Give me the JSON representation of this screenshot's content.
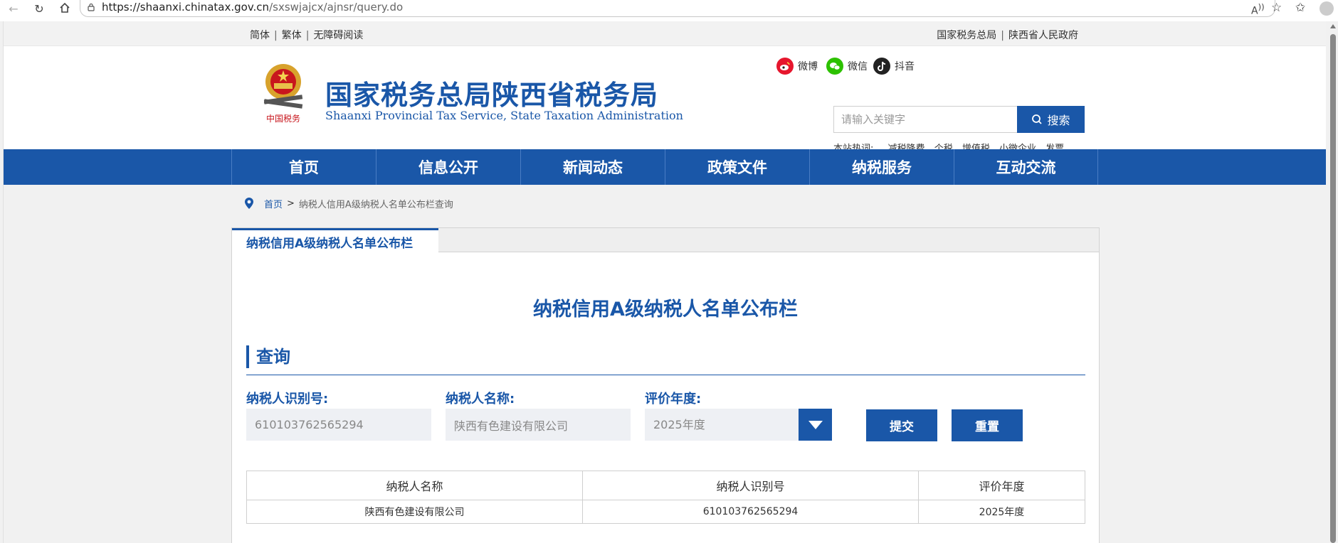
{
  "browser": {
    "url_host": "https://shaanxi.chinatax.gov.cn",
    "url_path": "/sxswjajcx/ajnsr/query.do"
  },
  "topbar": {
    "simplified": "简体",
    "traditional": "繁体",
    "accessibility": "无障碍阅读",
    "link_state_tax": "国家税务总局",
    "link_shaanxi_gov": "陕西省人民政府"
  },
  "header": {
    "title": "国家税务总局陕西省税务局",
    "subtitle": "Shaanxi Provincial Tax Service, State Taxation Administration",
    "emblem_text": "中国税务",
    "social": [
      {
        "label": "微博",
        "icon": "weibo-icon",
        "color": "#e6162d"
      },
      {
        "label": "微信",
        "icon": "wechat-icon",
        "color": "#2dc100"
      },
      {
        "label": "抖音",
        "icon": "douyin-icon",
        "color": "#222222"
      }
    ],
    "search_placeholder": "请输入关键字",
    "search_button": "搜索",
    "hotwords_label": "本站热词:",
    "hotwords": [
      "减税降费",
      "个税",
      "增值税",
      "小微企业",
      "发票"
    ]
  },
  "nav": [
    "首页",
    "信息公开",
    "新闻动态",
    "政策文件",
    "纳税服务",
    "互动交流"
  ],
  "breadcrumb": {
    "home": "首页",
    "separator": ">",
    "current": "纳税人信用A级纳税人名单公布栏查询"
  },
  "panel": {
    "tab": "纳税信用A级纳税人名单公布栏",
    "title": "纳税信用A级纳税人名单公布栏",
    "section": "查询",
    "form": {
      "id_label": "纳税人识别号:",
      "id_value": "610103762565294",
      "name_label": "纳税人名称:",
      "name_value": "陕西有色建设有限公司",
      "year_label": "评价年度:",
      "year_value": "2025年度",
      "submit": "提交",
      "reset": "重置"
    },
    "table": {
      "headers": [
        "纳税人名称",
        "纳税人识别号",
        "评价年度"
      ],
      "rows": [
        [
          "陕西有色建设有限公司",
          "610103762565294",
          "2025年度"
        ]
      ]
    }
  },
  "colors": {
    "brand_blue": "#1a57a8"
  }
}
